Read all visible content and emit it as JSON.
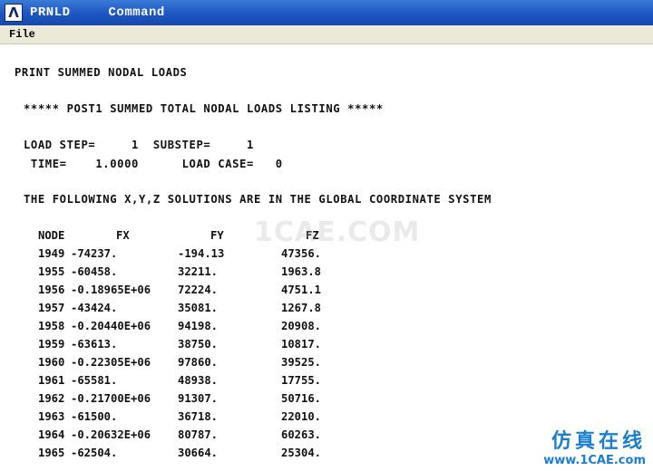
{
  "window": {
    "title": "PRNLD",
    "command_label": "Command",
    "app_icon_glyph": "Λ"
  },
  "menu": {
    "file": "File"
  },
  "listing": {
    "heading": "PRINT SUMMED NODAL LOADS",
    "banner": "***** POST1 SUMMED TOTAL NODAL LOADS LISTING *****",
    "load_step_line": "LOAD STEP=     1  SUBSTEP=     1",
    "time_line": " TIME=    1.0000      LOAD CASE=   0",
    "coord_line": "THE FOLLOWING X,Y,Z SOLUTIONS ARE IN THE GLOBAL COORDINATE SYSTEM",
    "columns": [
      "NODE",
      "FX",
      "FY",
      "FZ"
    ],
    "rows": [
      [
        "1949",
        "-74237.",
        "-194.13",
        "47356."
      ],
      [
        "1955",
        "-60458.",
        "32211.",
        "1963.8"
      ],
      [
        "1956",
        "-0.18965E+06",
        "72224.",
        "4751.1"
      ],
      [
        "1957",
        "-43424.",
        "35081.",
        "1267.8"
      ],
      [
        "1958",
        "-0.20440E+06",
        "94198.",
        "20908."
      ],
      [
        "1959",
        "-63613.",
        "38750.",
        "10817."
      ],
      [
        "1960",
        "-0.22305E+06",
        "97860.",
        "39525."
      ],
      [
        "1961",
        "-65581.",
        "48938.",
        "17755."
      ],
      [
        "1962",
        "-0.21700E+06",
        "91307.",
        "50716."
      ],
      [
        "1963",
        "-61500.",
        "36718.",
        "22010."
      ],
      [
        "1964",
        "-0.20632E+06",
        "80787.",
        "60263."
      ],
      [
        "1965",
        "-62504.",
        "30664.",
        "25304."
      ]
    ]
  },
  "watermark": "1CAE.COM",
  "branding": {
    "cn": "仿真在线",
    "url": "www.1CAE.com"
  }
}
